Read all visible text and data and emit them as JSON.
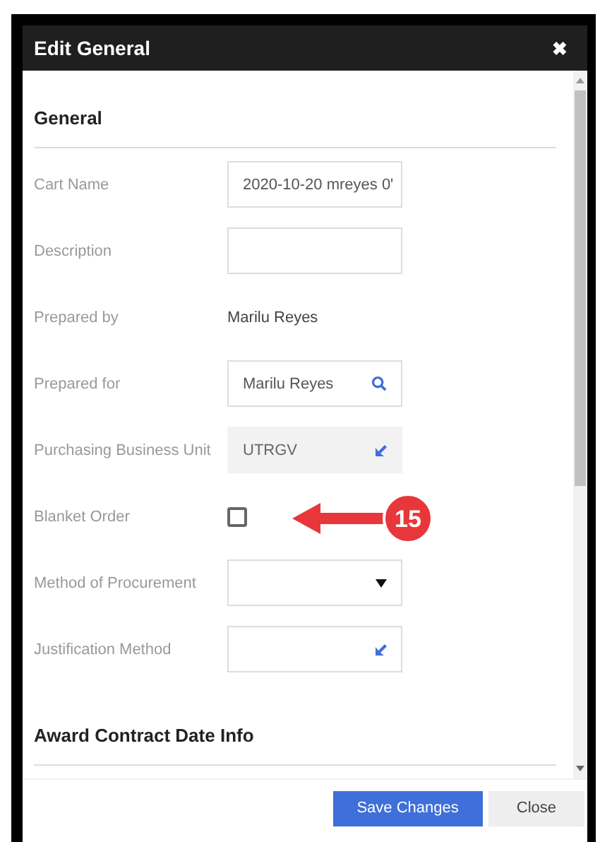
{
  "dialog": {
    "title": "Edit General",
    "close_icon": "✖"
  },
  "sections": [
    {
      "title": "General",
      "fields": [
        {
          "label": "Cart Name",
          "kind": "text",
          "value": "2020-10-20 mreyes 0'"
        },
        {
          "label": "Description",
          "kind": "text"
        },
        {
          "label": "Prepared by",
          "kind": "readonly",
          "value": "Marilu Reyes"
        },
        {
          "label": "Prepared for",
          "kind": "search",
          "value": "Marilu Reyes"
        },
        {
          "label": "Purchasing Business Unit",
          "kind": "lookup",
          "value": "UTRGV",
          "disabled": true
        },
        {
          "label": "Blanket Order",
          "kind": "checkbox",
          "checked": false,
          "callout": "15"
        },
        {
          "label": "Method of Procurement",
          "kind": "select"
        },
        {
          "label": "Justification Method",
          "kind": "lookup",
          "disabled": false
        }
      ]
    },
    {
      "title": "Award Contract Date Info"
    }
  ],
  "buttons": [
    {
      "label": "Save Changes",
      "kind": "primary"
    },
    {
      "label": "Close",
      "kind": "secondary"
    }
  ]
}
